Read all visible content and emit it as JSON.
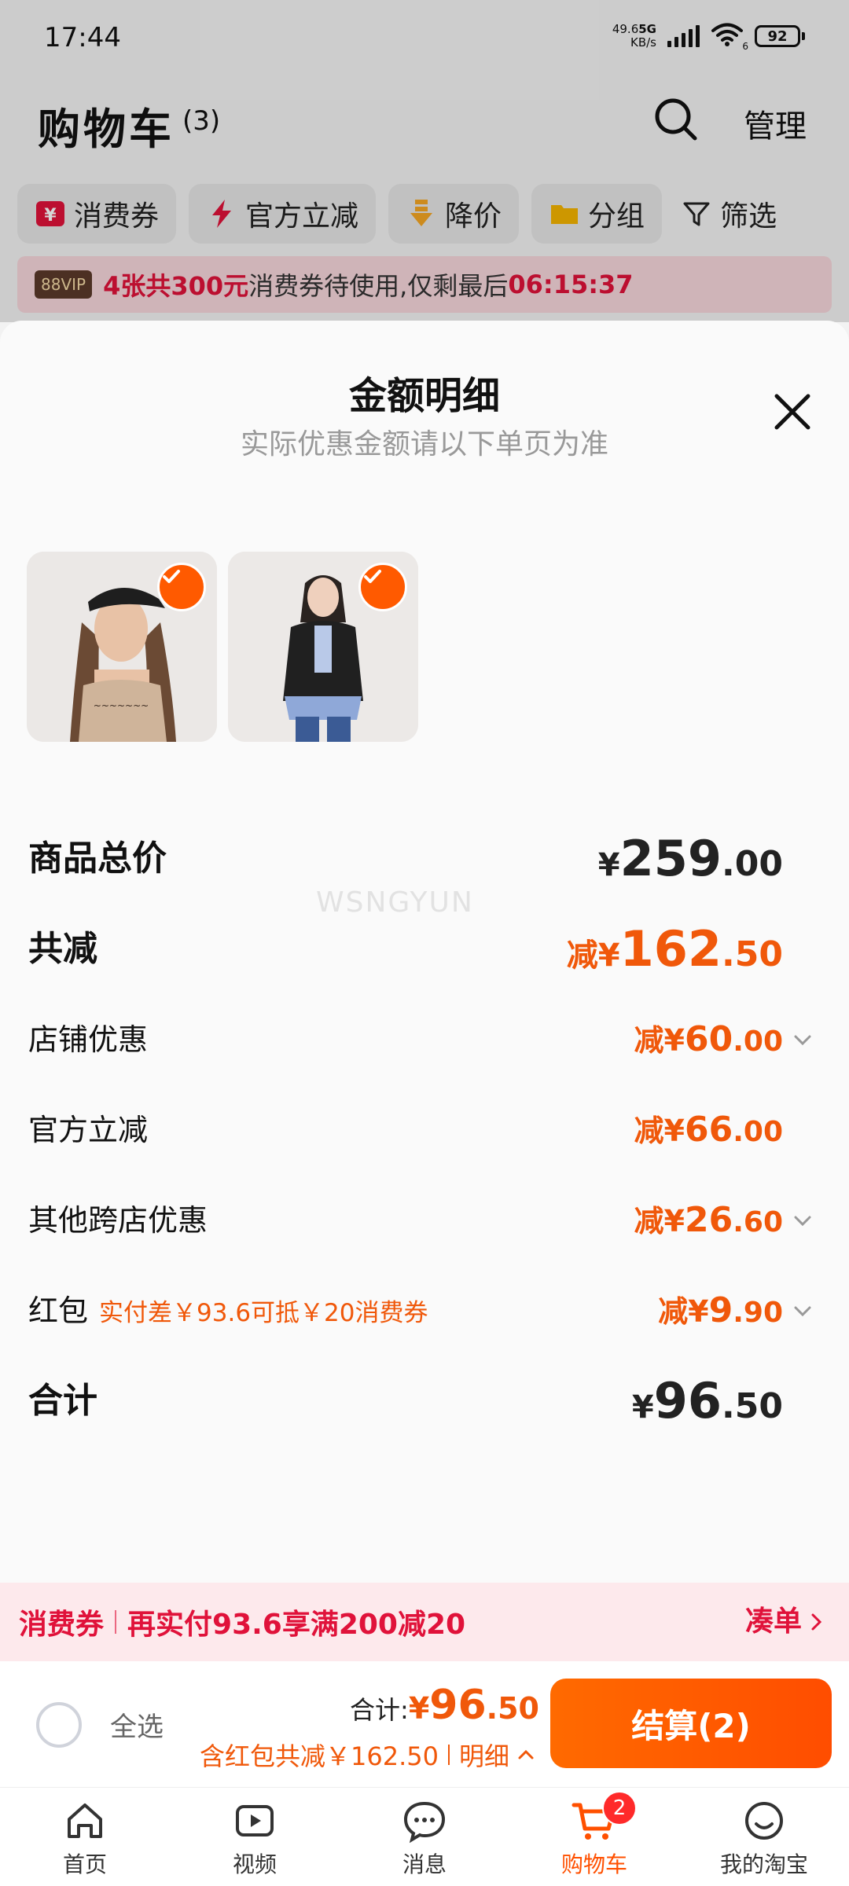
{
  "status_bar": {
    "time": "17:44",
    "net_speed_value": "49.6",
    "net_speed_unit": "KB/s",
    "network": "5G",
    "wifi_level": "6",
    "battery": "92"
  },
  "header": {
    "title": "购物车",
    "count": "(3)",
    "manage": "管理"
  },
  "filters": [
    {
      "label": "消费券",
      "icon": "coupon-icon"
    },
    {
      "label": "官方立减",
      "icon": "lightning-icon"
    },
    {
      "label": "降价",
      "icon": "price-drop-icon"
    },
    {
      "label": "分组",
      "icon": "folder-icon"
    },
    {
      "label": "筛选",
      "icon": "filter-icon"
    }
  ],
  "vip_banner": {
    "badge": "88VIP",
    "highlight": "4张共300元",
    "text": "消费券待使用,仅剩最后",
    "countdown": "06:15:37"
  },
  "sheet": {
    "title": "金额明细",
    "subtitle": "实际优惠金额请以下单页为准",
    "watermark": "WSNGYUN",
    "rows": {
      "goods_total": {
        "label": "商品总价",
        "currency": "¥",
        "int": "259",
        "dec": ".00"
      },
      "total_discount": {
        "label": "共减",
        "prefix": "减¥",
        "int": "162",
        "dec": ".50"
      },
      "shop_discount": {
        "label": "店铺优惠",
        "prefix": "减¥",
        "int": "60",
        "dec": ".00"
      },
      "official_discount": {
        "label": "官方立减",
        "prefix": "减¥",
        "int": "66",
        "dec": ".00"
      },
      "cross_shop": {
        "label": "其他跨店优惠",
        "prefix": "减¥",
        "int": "26",
        "dec": ".60"
      },
      "red_packet": {
        "label": "红包",
        "note": "实付差￥93.6可抵￥20消费券",
        "prefix": "减¥",
        "int": "9",
        "dec": ".90"
      },
      "sum": {
        "label": "合计",
        "currency": "¥",
        "int": "96",
        "dec": ".50"
      }
    }
  },
  "coupon_bar": {
    "tag": "消费券",
    "text": "再实付93.6享满200减20",
    "link": "凑单"
  },
  "checkout": {
    "select_all": "全选",
    "total_label": "合计:",
    "total_currency": "¥",
    "total_int": "96",
    "total_dec": ".50",
    "discount_text": "含红包共减￥162.50",
    "detail_link": "明细",
    "button": "结算(2)"
  },
  "tabs": [
    {
      "label": "首页",
      "icon": "home-icon"
    },
    {
      "label": "视频",
      "icon": "video-icon"
    },
    {
      "label": "消息",
      "icon": "message-icon"
    },
    {
      "label": "购物车",
      "icon": "cart-icon",
      "active": true,
      "badge": "2"
    },
    {
      "label": "我的淘宝",
      "icon": "profile-icon"
    }
  ],
  "colors": {
    "accent": "#ff5000",
    "price_orange": "#f0580a",
    "promo_red": "#e0123a"
  }
}
